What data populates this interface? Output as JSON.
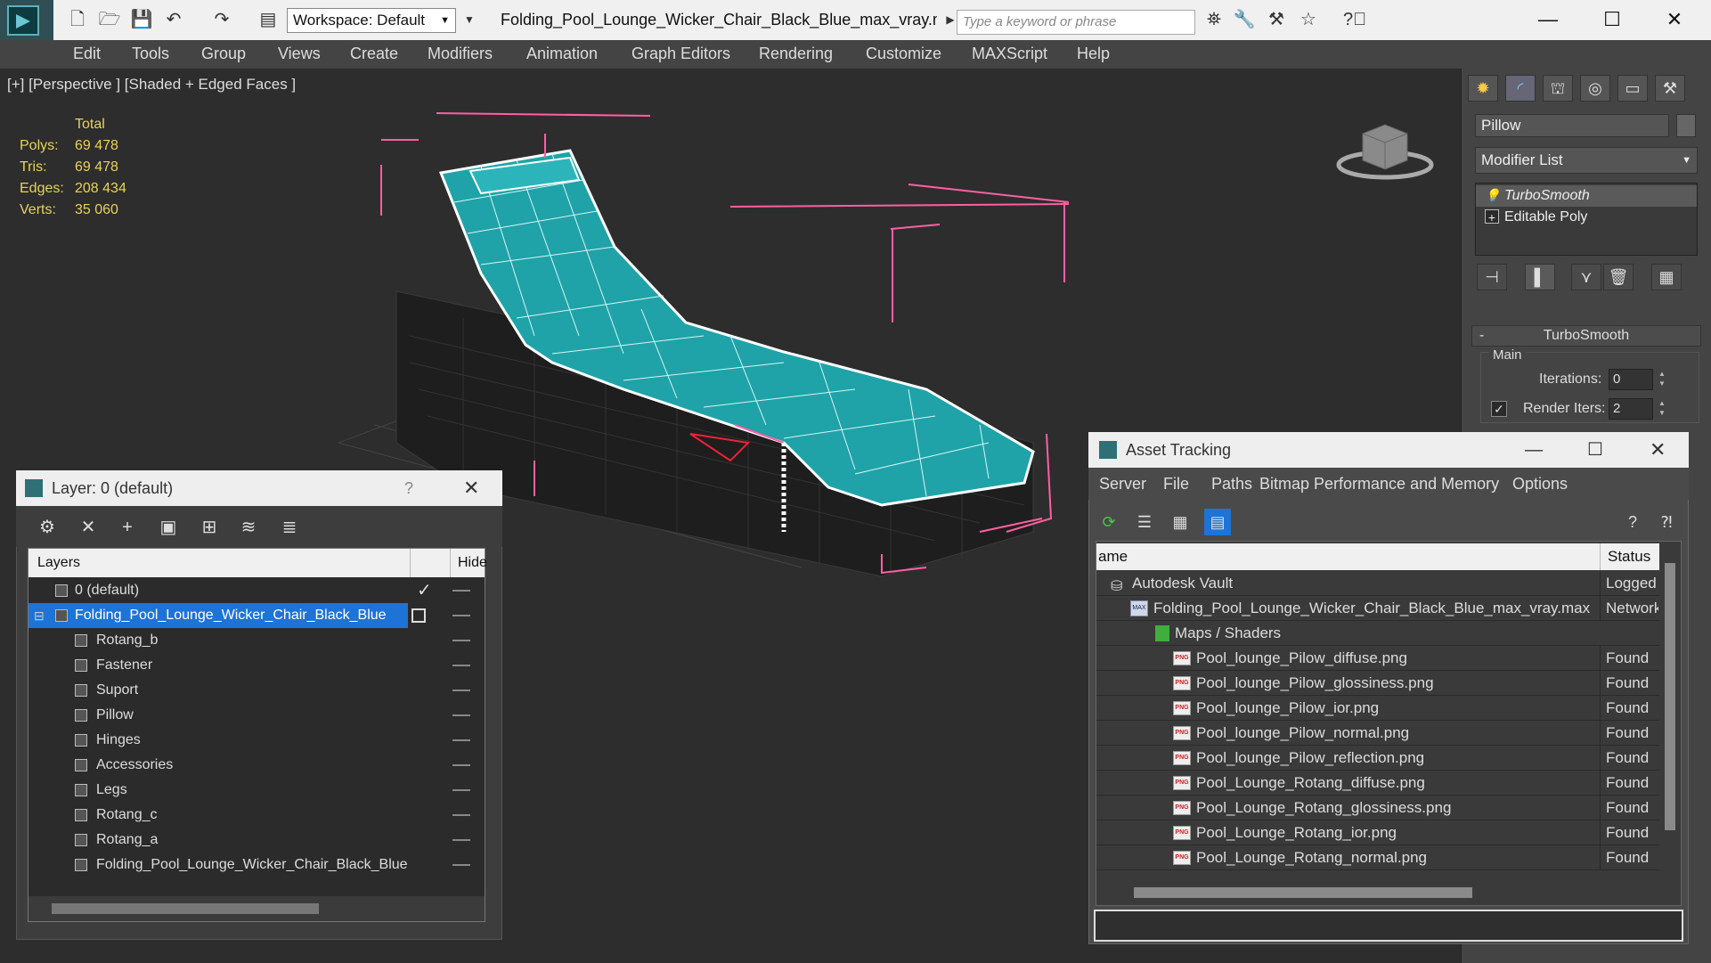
{
  "titlebar": {
    "workspace_label": "Workspace: Default",
    "document_title": "Folding_Pool_Lounge_Wicker_Chair_Black_Blue_max_vray.m...",
    "search_placeholder": "Type a keyword or phrase"
  },
  "menu": [
    "Edit",
    "Tools",
    "Group",
    "Views",
    "Create",
    "Modifiers",
    "Animation",
    "Graph Editors",
    "Rendering",
    "Customize",
    "MAXScript",
    "Help"
  ],
  "viewport": {
    "label": "[+] [Perspective ] [Shaded + Edged Faces ]",
    "stats": {
      "header": "Total",
      "rows": [
        {
          "key": "Polys:",
          "value": "69 478"
        },
        {
          "key": "Tris:",
          "value": "69 478"
        },
        {
          "key": "Edges:",
          "value": "208 434"
        },
        {
          "key": "Verts:",
          "value": "35 060"
        }
      ]
    }
  },
  "command_panel": {
    "object_name": "Pillow",
    "modifier_list": "Modifier List",
    "stack": [
      "TurboSmooth",
      "Editable Poly"
    ],
    "turbosmooth": {
      "title": "TurboSmooth",
      "group": "Main",
      "iterations_label": "Iterations:",
      "iterations_value": "0",
      "render_iters_label": "Render Iters:",
      "render_iters_value": "2"
    }
  },
  "layer_window": {
    "title": "Layer: 0 (default)",
    "help": "?",
    "col_layers": "Layers",
    "col_hide": "Hide",
    "rows": [
      {
        "name": "0 (default)",
        "level": 0
      },
      {
        "name": "Folding_Pool_Lounge_Wicker_Chair_Black_Blue",
        "level": 0
      },
      {
        "name": "Rotang_b",
        "level": 1
      },
      {
        "name": "Fastener",
        "level": 1
      },
      {
        "name": "Suport",
        "level": 1
      },
      {
        "name": "Pillow",
        "level": 1
      },
      {
        "name": "Hinges",
        "level": 1
      },
      {
        "name": "Accessories",
        "level": 1
      },
      {
        "name": "Legs",
        "level": 1
      },
      {
        "name": "Rotang_c",
        "level": 1
      },
      {
        "name": "Rotang_a",
        "level": 1
      },
      {
        "name": "Folding_Pool_Lounge_Wicker_Chair_Black_Blue",
        "level": 1
      }
    ]
  },
  "asset_window": {
    "title": "Asset Tracking",
    "menu": [
      "Server",
      "File",
      "Paths",
      "Bitmap Performance and Memory",
      "Options"
    ],
    "col_name": "ame",
    "col_status": "Status",
    "rows": [
      {
        "name": "Autodesk Vault",
        "status": "Logged O"
      },
      {
        "name": "Folding_Pool_Lounge_Wicker_Chair_Black_Blue_max_vray.max",
        "status": "Network"
      },
      {
        "name": "Maps / Shaders",
        "status": ""
      },
      {
        "name": "Pool_lounge_Pilow_diffuse.png",
        "status": "Found"
      },
      {
        "name": "Pool_lounge_Pilow_glossiness.png",
        "status": "Found"
      },
      {
        "name": "Pool_lounge_Pilow_ior.png",
        "status": "Found"
      },
      {
        "name": "Pool_lounge_Pilow_normal.png",
        "status": "Found"
      },
      {
        "name": "Pool_lounge_Pilow_reflection.png",
        "status": "Found"
      },
      {
        "name": "Pool_Lounge_Rotang_diffuse.png",
        "status": "Found"
      },
      {
        "name": "Pool_Lounge_Rotang_glossiness.png",
        "status": "Found"
      },
      {
        "name": "Pool_Lounge_Rotang_ior.png",
        "status": "Found"
      },
      {
        "name": "Pool_Lounge_Rotang_normal.png",
        "status": "Found"
      }
    ]
  },
  "colors": {
    "accent": "#1e73d6",
    "stats_text": "#e8d35a",
    "cushion": "#1fa3a8",
    "selection_box": "#ff5fa2",
    "viewport_bg": "#2d2d2d"
  }
}
